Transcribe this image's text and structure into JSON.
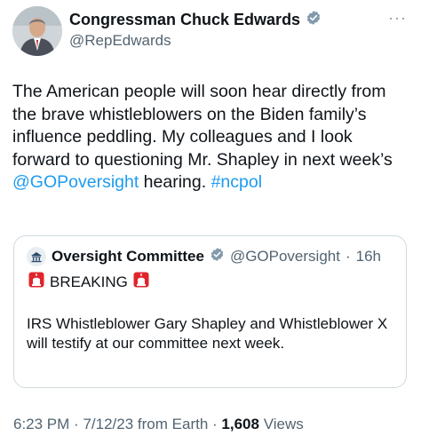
{
  "author": {
    "display_name": "Congressman Chuck Edwards",
    "handle": "@RepEdwards",
    "verified_icon": "verified-badge-icon"
  },
  "more_icon": "···",
  "tweet": {
    "text_1": "The American people will soon hear directly from the brave whistleblowers on the Biden family’s influence peddling. My colleagues and I look forward to questioning Mr. Shapley in next week’s ",
    "mention": "@GOPoversight",
    "text_2": " hearing. ",
    "hashtag": "#ncpol"
  },
  "quote": {
    "name": "Oversight Committee",
    "handle": "@GOPoversight",
    "separator": "·",
    "time": "16h",
    "breaking": "BREAKING",
    "text": "IRS Whistleblower Gary Shapley and Whistleblower X will testify at our committee next week."
  },
  "meta": {
    "time": "6:23 PM",
    "date": "7/12/23",
    "source": "from Earth",
    "views_count": "1,608",
    "views_label": "Views"
  },
  "colors": {
    "link": "#1d9bf0",
    "verified_blue": "#1d9bf0",
    "verified_gray": "#829aab",
    "siren_red": "#e0242b"
  }
}
